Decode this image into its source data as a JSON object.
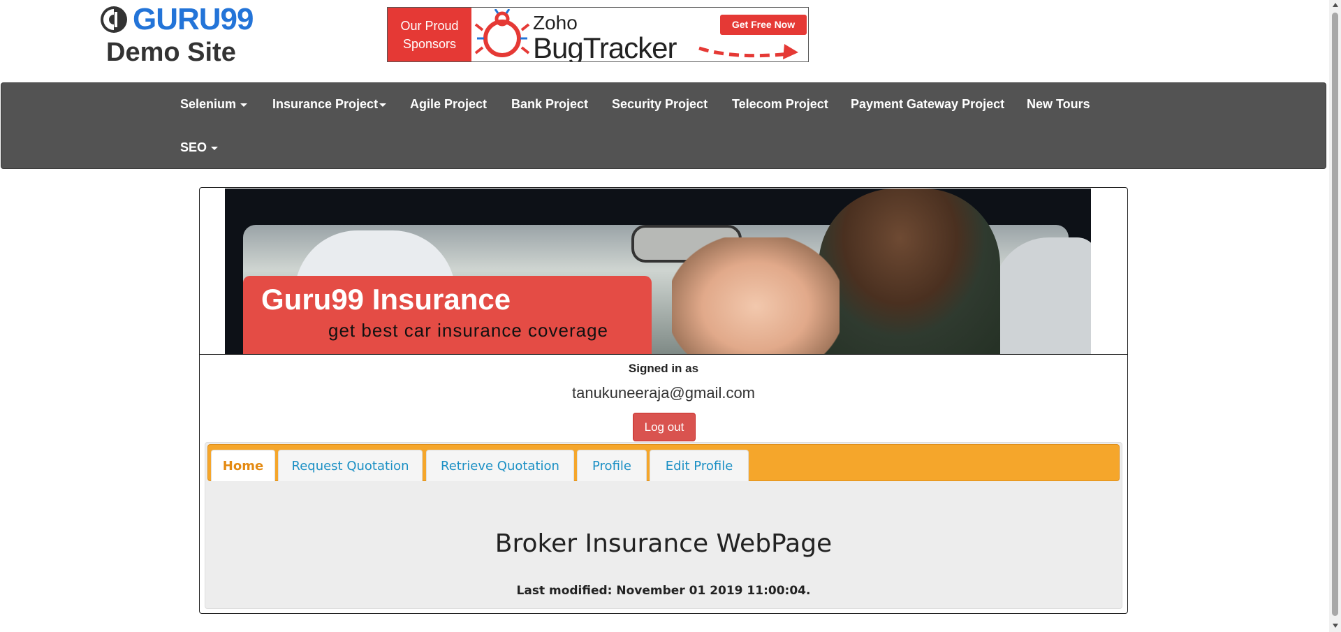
{
  "header": {
    "logo_word": "GURU99",
    "logo_sub": "Demo Site",
    "sponsor": {
      "left_line1": "Our Proud",
      "left_line2": "Sponsors",
      "brand": "Zoho",
      "product": "BugTracker",
      "cta": "Get Free Now"
    }
  },
  "nav": {
    "items": [
      {
        "label": "Selenium",
        "dropdown": true
      },
      {
        "label": "Insurance Project",
        "dropdown": true
      },
      {
        "label": "Agile Project",
        "dropdown": false
      },
      {
        "label": "Bank Project",
        "dropdown": false
      },
      {
        "label": "Security Project",
        "dropdown": false
      },
      {
        "label": "Telecom Project",
        "dropdown": false
      },
      {
        "label": "Payment Gateway Project",
        "dropdown": false
      },
      {
        "label": "New Tours",
        "dropdown": false
      },
      {
        "label": "SEO",
        "dropdown": true
      }
    ]
  },
  "banner": {
    "title": "Guru99 Insurance",
    "tagline": "get best car insurance coverage"
  },
  "account": {
    "signed_in_label": "Signed in as",
    "email": "tanukuneeraja@gmail.com",
    "logout_label": "Log out"
  },
  "tabs": [
    {
      "label": "Home",
      "active": true
    },
    {
      "label": "Request Quotation",
      "active": false
    },
    {
      "label": "Retrieve Quotation",
      "active": false
    },
    {
      "label": "Profile",
      "active": false
    },
    {
      "label": "Edit Profile",
      "active": false
    }
  ],
  "main": {
    "heading": "Broker Insurance WebPage",
    "last_modified": "Last modified: November 01 2019 11:00:04."
  },
  "colors": {
    "nav_bg": "#535353",
    "tabbar": "#f5a62b",
    "active_tab_text": "#e48a12",
    "tab_text": "#1a8fc4",
    "logout": "#d9534f",
    "brand_red": "#e53935",
    "logo_blue": "#2374d8"
  }
}
